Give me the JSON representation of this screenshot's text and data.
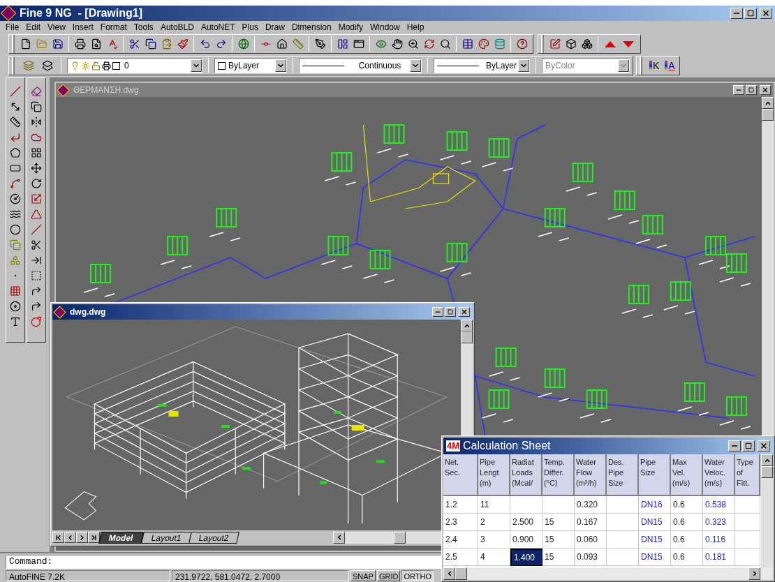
{
  "app": {
    "title": "Fine 9 NG  - [Drawing1]"
  },
  "menu": [
    "File",
    "Edit",
    "View",
    "Insert",
    "Format",
    "Tools",
    "AutoBLD",
    "AutoNET",
    "Plus",
    "Draw",
    "Dimension",
    "Modify",
    "Window",
    "Help"
  ],
  "layer_toolbar": {
    "layer": "0",
    "color_setting": "ByLayer",
    "linetype": "Continuous",
    "lineweight": "ByLayer",
    "plot_style": {
      "value": "ByColor",
      "disabled": true
    }
  },
  "style_buttons": [
    "K",
    "A"
  ],
  "main_drawing": {
    "title": "ΘΕΡΜΑΝΣΗ.dwg"
  },
  "model_view": {
    "title": "dwg.dwg",
    "tabs": [
      {
        "label": "Model",
        "selected": true
      },
      {
        "label": "Layout1",
        "selected": false
      },
      {
        "label": "Layout2",
        "selected": false
      }
    ]
  },
  "calc_sheet": {
    "logo": "4M",
    "title": "Calculation Sheet",
    "columns": [
      {
        "lines": [
          "Net.",
          "Sec."
        ]
      },
      {
        "lines": [
          "Pipe",
          "Lengt",
          "(m)"
        ]
      },
      {
        "lines": [
          "Radiat",
          "Loads",
          "(Mcal/"
        ]
      },
      {
        "lines": [
          "Temp.",
          "Differ.",
          "(°C)"
        ]
      },
      {
        "lines": [
          "Water",
          "Flow",
          "(m³/h)"
        ]
      },
      {
        "lines": [
          "Des.",
          "Pipe",
          "Size"
        ]
      },
      {
        "lines": [
          "Pipe",
          "Size"
        ]
      },
      {
        "lines": [
          "Max",
          "Vel.",
          "(m/s)"
        ]
      },
      {
        "lines": [
          "Water",
          "Veloc.",
          "(m/s)"
        ]
      },
      {
        "lines": [
          "Type",
          "of",
          "Fitt."
        ]
      }
    ],
    "rows": [
      {
        "cells": [
          {
            "text": "1.2",
            "selected": false,
            "computed": false
          },
          {
            "text": "11",
            "selected": false,
            "computed": false
          },
          {
            "selected": false
          },
          {
            "selected": false
          },
          {
            "text": "0.320",
            "selected": false,
            "computed": false
          },
          {
            "selected": false
          },
          {
            "text": "DN16",
            "selected": false,
            "computed": true
          },
          {
            "text": "0.6",
            "selected": false,
            "computed": false
          },
          {
            "text": "0.538",
            "selected": false,
            "computed": true
          },
          {
            "selected": false
          }
        ]
      },
      {
        "cells": [
          {
            "text": "2.3",
            "selected": false,
            "computed": false
          },
          {
            "text": "2",
            "selected": false,
            "computed": false
          },
          {
            "text": "2.500",
            "selected": false,
            "computed": false
          },
          {
            "text": "15",
            "selected": false,
            "computed": false
          },
          {
            "text": "0.167",
            "selected": false,
            "computed": false
          },
          {
            "selected": false
          },
          {
            "text": "DN15",
            "selected": false,
            "computed": true
          },
          {
            "text": "0.6",
            "selected": false,
            "computed": false
          },
          {
            "text": "0.323",
            "selected": false,
            "computed": true
          },
          {
            "selected": false
          }
        ]
      },
      {
        "cells": [
          {
            "text": "2.4",
            "selected": false,
            "computed": false
          },
          {
            "text": "3",
            "selected": false,
            "computed": false
          },
          {
            "text": "0.900",
            "selected": false,
            "computed": false
          },
          {
            "text": "15",
            "selected": false,
            "computed": false
          },
          {
            "text": "0.060",
            "selected": false,
            "computed": false
          },
          {
            "selected": false
          },
          {
            "text": "DN15",
            "selected": false,
            "computed": true
          },
          {
            "text": "0.6",
            "selected": false,
            "computed": false
          },
          {
            "text": "0.116",
            "selected": false,
            "computed": true
          },
          {
            "selected": false
          }
        ]
      },
      {
        "cells": [
          {
            "text": "2.5",
            "selected": false,
            "computed": false
          },
          {
            "text": "4",
            "selected": false,
            "computed": false
          },
          {
            "text": "1.400",
            "selected": true,
            "computed": false
          },
          {
            "text": "15",
            "selected": false,
            "computed": false
          },
          {
            "text": "0.093",
            "selected": false,
            "computed": false
          },
          {
            "selected": false
          },
          {
            "text": "DN15",
            "selected": false,
            "computed": true
          },
          {
            "text": "0.6",
            "selected": false,
            "computed": false
          },
          {
            "text": "0.181",
            "selected": false,
            "computed": true
          },
          {
            "selected": false
          }
        ]
      }
    ]
  },
  "command": {
    "prompt": "Command:"
  },
  "status_bar": {
    "product": "AutoFINE 7.2K",
    "coordinates": "231.9722, 581.0472, 2.7000",
    "toggles": [
      {
        "label": "SNAP",
        "on": false
      },
      {
        "label": "GRID",
        "on": false
      },
      {
        "label": "ORTHO",
        "on": true
      }
    ]
  }
}
